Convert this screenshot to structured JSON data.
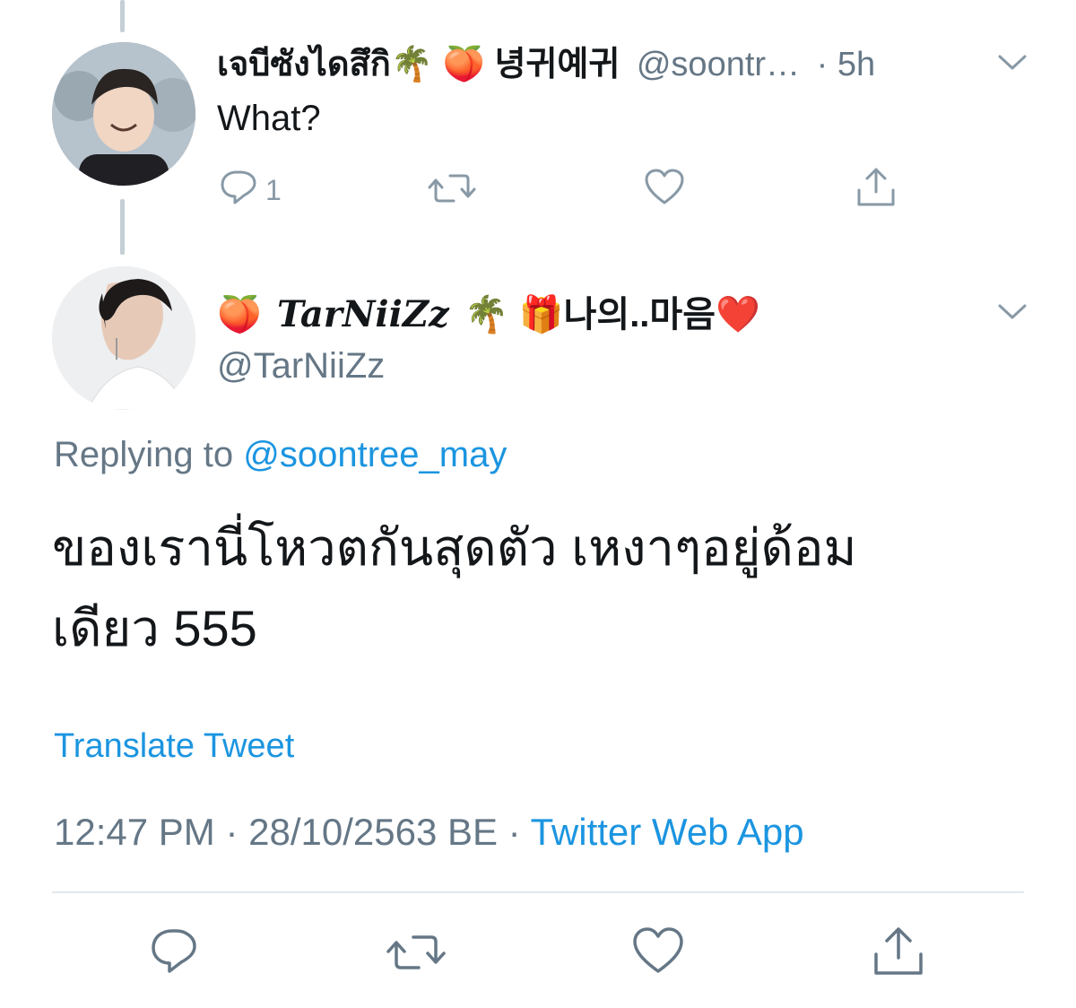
{
  "parent_tweet": {
    "display_name": "เจบีซังไดสึกิ🌴 🍑 녕귀예귀",
    "handle": "@soontr…",
    "time": "· 5h",
    "text": "What?",
    "reply_count": "1"
  },
  "main_tweet": {
    "display_name_emoji_1": "🍑",
    "display_name_text": "TarNiiZz",
    "display_name_emoji_2": "🌴 🎁",
    "display_name_suffix": "나의..마음",
    "display_name_heart": "❤️",
    "handle": "@TarNiiZz",
    "replying_prefix": "Replying to",
    "replying_to": "@soontree_may",
    "text_line_1": "ของเรานี่โหวตกันสุดตัว เหงาๆอยู่ด้อม",
    "text_line_2": "เดียว 555",
    "translate_label": "Translate Tweet",
    "timestamp": "12:47 PM · 28/10/2563 BE ·",
    "source": "Twitter Web App"
  },
  "colors": {
    "accent": "#1b95e0",
    "muted": "#657786",
    "text": "#14171a",
    "thread_line": "#c4cfd6",
    "divider": "#e1e8ed"
  },
  "icons": [
    "reply-icon",
    "retweet-icon",
    "like-icon",
    "share-icon",
    "chevron-down-icon"
  ]
}
